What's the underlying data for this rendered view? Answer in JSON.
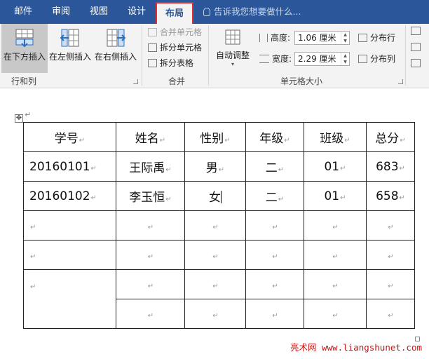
{
  "tabs": [
    {
      "label": "邮件"
    },
    {
      "label": "审阅"
    },
    {
      "label": "视图"
    },
    {
      "label": "设计"
    },
    {
      "label": "布局",
      "active": true
    }
  ],
  "tell_me": {
    "placeholder": "告诉我您想要做什么..."
  },
  "ribbon": {
    "rows_cols": {
      "insert_below": "在下方插入",
      "insert_left": "在左侧插入",
      "insert_right": "在右侧插入",
      "label": "行和列"
    },
    "merge": {
      "merge_cells": "合并单元格",
      "split_cells": "拆分单元格",
      "split_table": "拆分表格",
      "label": "合并"
    },
    "cell_size": {
      "autofit": "自动调整",
      "height_label": "高度:",
      "height_value": "1.06 厘米",
      "width_label": "宽度:",
      "width_value": "2.29 厘米",
      "distribute_rows": "分布行",
      "distribute_cols": "分布列",
      "label": "单元格大小"
    }
  },
  "table": {
    "headers": [
      "学号",
      "姓名",
      "性别",
      "年级",
      "班级",
      "总分"
    ],
    "rows": [
      [
        "20160101",
        "王际禹",
        "男",
        "二",
        "01",
        "683"
      ],
      [
        "20160102",
        "李玉恒",
        "女",
        "二",
        "01",
        "658"
      ]
    ]
  },
  "colors": {
    "accent": "#2b579a",
    "active_tab_outline": "#e03030",
    "watermark": "#d01010"
  },
  "watermark": "亮术网 www.liangshunet.com"
}
